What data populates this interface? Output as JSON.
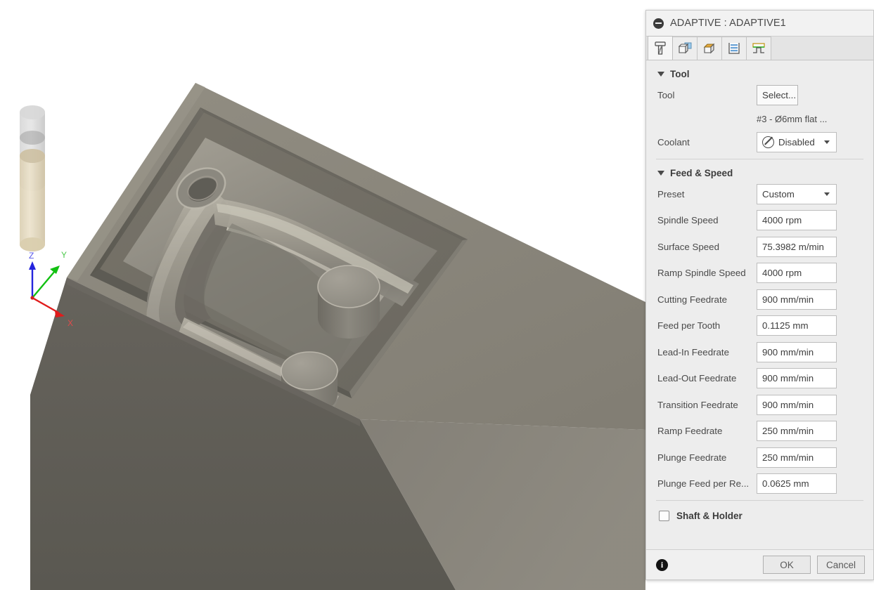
{
  "panel": {
    "title": "ADAPTIVE : ADAPTIVE1",
    "collapse_icon": "minus-circle-icon",
    "tabs": [
      {
        "name": "tool-tab",
        "icon": "endmill-tool-icon",
        "active": true
      },
      {
        "name": "geometry-tab",
        "icon": "geometry-faces-icon",
        "active": false
      },
      {
        "name": "heights-tab",
        "icon": "stock-box-icon",
        "active": false
      },
      {
        "name": "passes-tab",
        "icon": "passes-layers-icon",
        "active": false
      },
      {
        "name": "linking-tab",
        "icon": "linking-ramp-icon",
        "active": false
      }
    ],
    "groups": [
      {
        "name": "tool",
        "title": "Tool",
        "expanded": true,
        "rows": [
          {
            "type": "button",
            "label": "Tool",
            "value": "Select..."
          },
          {
            "type": "subline",
            "value": "#3 - Ø6mm flat ..."
          },
          {
            "type": "select",
            "label": "Coolant",
            "value": "Disabled",
            "icon": "no-entry-icon"
          }
        ]
      },
      {
        "name": "feed-and-speed",
        "title": "Feed & Speed",
        "expanded": true,
        "rows": [
          {
            "type": "select",
            "label": "Preset",
            "value": "Custom"
          },
          {
            "type": "input",
            "label": "Spindle Speed",
            "value": "4000 rpm"
          },
          {
            "type": "input",
            "label": "Surface Speed",
            "value": "75.3982 m/min"
          },
          {
            "type": "input",
            "label": "Ramp Spindle Speed",
            "value": "4000 rpm"
          },
          {
            "type": "input",
            "label": "Cutting Feedrate",
            "value": "900 mm/min"
          },
          {
            "type": "input",
            "label": "Feed per Tooth",
            "value": "0.1125 mm"
          },
          {
            "type": "input",
            "label": "Lead-In Feedrate",
            "value": "900 mm/min"
          },
          {
            "type": "input",
            "label": "Lead-Out Feedrate",
            "value": "900 mm/min"
          },
          {
            "type": "input",
            "label": "Transition Feedrate",
            "value": "900 mm/min"
          },
          {
            "type": "input",
            "label": "Ramp Feedrate",
            "value": "250 mm/min"
          },
          {
            "type": "input",
            "label": "Plunge Feedrate",
            "value": "250 mm/min"
          },
          {
            "type": "input",
            "label": "Plunge Feed per Re...",
            "value": "0.0625 mm"
          }
        ]
      }
    ],
    "shaft_holder": {
      "label": "Shaft & Holder",
      "checked": false
    },
    "footer": {
      "info_icon": "info-icon",
      "ok_label": "OK",
      "cancel_label": "Cancel"
    }
  },
  "viewport": {
    "name": "cam-3d-viewport",
    "background": "#ffffff",
    "axis_indicator": {
      "x_label": "X",
      "x_color": "#e01b1b",
      "y_label": "Y",
      "y_color": "#11c011",
      "z_label": "Z",
      "z_color": "#2424dd"
    },
    "tool_preview": {
      "name": "tool-cylinder",
      "holder_color": "#bdbdbd",
      "flute_color": "#e2d5b7"
    },
    "stock": {
      "top_color": "#8c887d",
      "pocket_floor_color": "#6f6c64",
      "front_color": "#5c5a54",
      "side_color": "#807c73",
      "part_color": "#8f8c84"
    }
  }
}
